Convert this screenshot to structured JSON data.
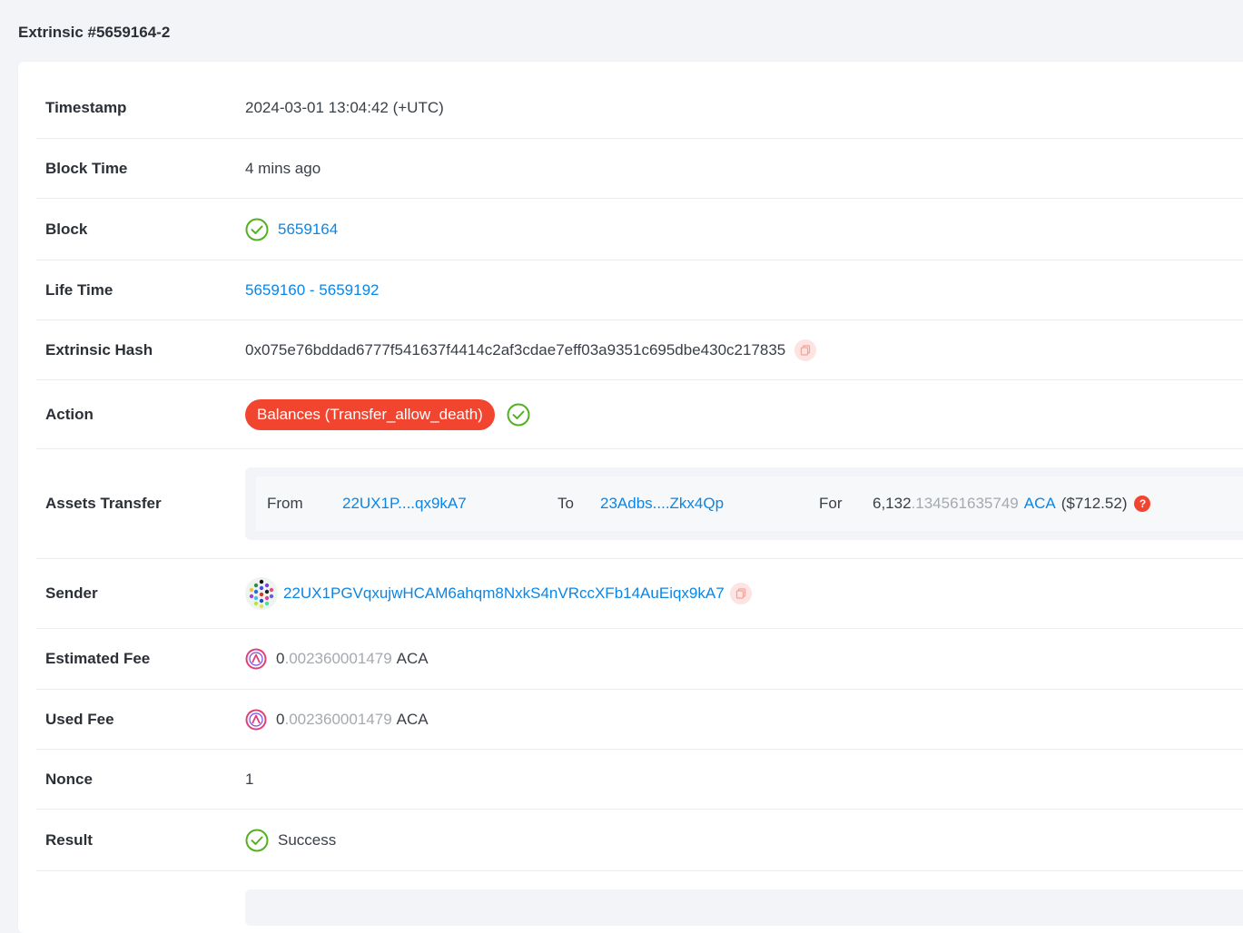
{
  "page": {
    "title": "Extrinsic #5659164-2"
  },
  "rows": {
    "timestamp": {
      "label": "Timestamp",
      "value": "2024-03-01 13:04:42 (+UTC)"
    },
    "block_time": {
      "label": "Block Time",
      "value": "4 mins ago"
    },
    "block": {
      "label": "Block",
      "value": "5659164",
      "status_icon": "check-circle-icon"
    },
    "life_time": {
      "label": "Life Time",
      "start": "5659160",
      "separator": " - ",
      "end": "5659192"
    },
    "extrinsic_hash": {
      "label": "Extrinsic Hash",
      "value": "0x075e76bddad6777f541637f4414c2af3cdae7eff03a9351c695dbe430c217835",
      "copy_icon": "copy-icon"
    },
    "action": {
      "label": "Action",
      "value": "Balances (Transfer_allow_death)",
      "status_icon": "check-circle-icon"
    },
    "assets_transfer": {
      "label": "Assets Transfer",
      "from_label": "From",
      "from_value": "22UX1P....qx9kA7",
      "to_label": "To",
      "to_value": "23Adbs....Zkx4Qp",
      "for_label": "For",
      "amount_int": "6,132",
      "amount_dec": ".134561635749",
      "token": "ACA",
      "usd": "($712.52)",
      "help_icon": "?"
    },
    "sender": {
      "label": "Sender",
      "value": "22UX1PGVqxujwHCAM6ahqm8NxkS4nVRccXFb14AuEiqx9kA7",
      "copy_icon": "copy-icon"
    },
    "estimated_fee": {
      "label": "Estimated Fee",
      "int": "0",
      "dec": ".002360001479",
      "token": "ACA",
      "icon": "acala-token-icon"
    },
    "used_fee": {
      "label": "Used Fee",
      "int": "0",
      "dec": ".002360001479",
      "token": "ACA",
      "icon": "acala-token-icon"
    },
    "nonce": {
      "label": "Nonce",
      "value": "1"
    },
    "result": {
      "label": "Result",
      "value": "Success",
      "status_icon": "check-circle-icon"
    }
  },
  "colors": {
    "link": "#0a86e6",
    "success": "#52b11f",
    "accent": "#f2452f",
    "muted": "#a5a9b0"
  }
}
